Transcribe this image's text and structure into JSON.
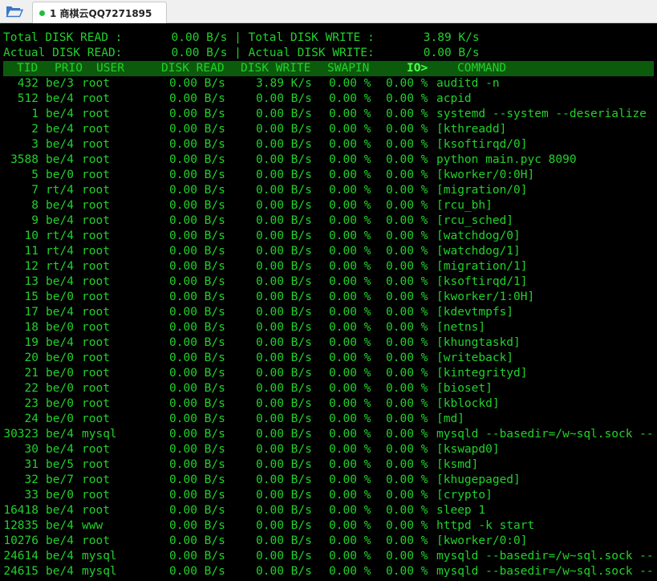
{
  "tab": {
    "title": "1 商棋云QQ7271895"
  },
  "summary": {
    "line1": "Total DISK READ :       0.00 B/s | Total DISK WRITE :       3.89 K/s",
    "line2": "Actual DISK READ:       0.00 B/s | Actual DISK WRITE:       0.00 B/s"
  },
  "header": {
    "tid": "TID",
    "prio": "PRIO",
    "user": "USER",
    "disk_read": "DISK READ",
    "disk_write": "DISK WRITE",
    "swapin": "SWAPIN",
    "io": "IO>",
    "command": "COMMAND"
  },
  "rows": [
    {
      "tid": "432",
      "prio": "be/3",
      "user": "root",
      "read": "0.00 B/s",
      "write": "3.89 K/s",
      "swapin": "0.00 %",
      "io": "0.00 %",
      "cmd": "auditd -n"
    },
    {
      "tid": "512",
      "prio": "be/4",
      "user": "root",
      "read": "0.00 B/s",
      "write": "0.00 B/s",
      "swapin": "0.00 %",
      "io": "0.00 %",
      "cmd": "acpid"
    },
    {
      "tid": "1",
      "prio": "be/4",
      "user": "root",
      "read": "0.00 B/s",
      "write": "0.00 B/s",
      "swapin": "0.00 %",
      "io": "0.00 %",
      "cmd": "systemd --system --deserialize"
    },
    {
      "tid": "2",
      "prio": "be/4",
      "user": "root",
      "read": "0.00 B/s",
      "write": "0.00 B/s",
      "swapin": "0.00 %",
      "io": "0.00 %",
      "cmd": "[kthreadd]"
    },
    {
      "tid": "3",
      "prio": "be/4",
      "user": "root",
      "read": "0.00 B/s",
      "write": "0.00 B/s",
      "swapin": "0.00 %",
      "io": "0.00 %",
      "cmd": "[ksoftirqd/0]"
    },
    {
      "tid": "3588",
      "prio": "be/4",
      "user": "root",
      "read": "0.00 B/s",
      "write": "0.00 B/s",
      "swapin": "0.00 %",
      "io": "0.00 %",
      "cmd": "python main.pyc 8090"
    },
    {
      "tid": "5",
      "prio": "be/0",
      "user": "root",
      "read": "0.00 B/s",
      "write": "0.00 B/s",
      "swapin": "0.00 %",
      "io": "0.00 %",
      "cmd": "[kworker/0:0H]"
    },
    {
      "tid": "7",
      "prio": "rt/4",
      "user": "root",
      "read": "0.00 B/s",
      "write": "0.00 B/s",
      "swapin": "0.00 %",
      "io": "0.00 %",
      "cmd": "[migration/0]"
    },
    {
      "tid": "8",
      "prio": "be/4",
      "user": "root",
      "read": "0.00 B/s",
      "write": "0.00 B/s",
      "swapin": "0.00 %",
      "io": "0.00 %",
      "cmd": "[rcu_bh]"
    },
    {
      "tid": "9",
      "prio": "be/4",
      "user": "root",
      "read": "0.00 B/s",
      "write": "0.00 B/s",
      "swapin": "0.00 %",
      "io": "0.00 %",
      "cmd": "[rcu_sched]"
    },
    {
      "tid": "10",
      "prio": "rt/4",
      "user": "root",
      "read": "0.00 B/s",
      "write": "0.00 B/s",
      "swapin": "0.00 %",
      "io": "0.00 %",
      "cmd": "[watchdog/0]"
    },
    {
      "tid": "11",
      "prio": "rt/4",
      "user": "root",
      "read": "0.00 B/s",
      "write": "0.00 B/s",
      "swapin": "0.00 %",
      "io": "0.00 %",
      "cmd": "[watchdog/1]"
    },
    {
      "tid": "12",
      "prio": "rt/4",
      "user": "root",
      "read": "0.00 B/s",
      "write": "0.00 B/s",
      "swapin": "0.00 %",
      "io": "0.00 %",
      "cmd": "[migration/1]"
    },
    {
      "tid": "13",
      "prio": "be/4",
      "user": "root",
      "read": "0.00 B/s",
      "write": "0.00 B/s",
      "swapin": "0.00 %",
      "io": "0.00 %",
      "cmd": "[ksoftirqd/1]"
    },
    {
      "tid": "15",
      "prio": "be/0",
      "user": "root",
      "read": "0.00 B/s",
      "write": "0.00 B/s",
      "swapin": "0.00 %",
      "io": "0.00 %",
      "cmd": "[kworker/1:0H]"
    },
    {
      "tid": "17",
      "prio": "be/4",
      "user": "root",
      "read": "0.00 B/s",
      "write": "0.00 B/s",
      "swapin": "0.00 %",
      "io": "0.00 %",
      "cmd": "[kdevtmpfs]"
    },
    {
      "tid": "18",
      "prio": "be/0",
      "user": "root",
      "read": "0.00 B/s",
      "write": "0.00 B/s",
      "swapin": "0.00 %",
      "io": "0.00 %",
      "cmd": "[netns]"
    },
    {
      "tid": "19",
      "prio": "be/4",
      "user": "root",
      "read": "0.00 B/s",
      "write": "0.00 B/s",
      "swapin": "0.00 %",
      "io": "0.00 %",
      "cmd": "[khungtaskd]"
    },
    {
      "tid": "20",
      "prio": "be/0",
      "user": "root",
      "read": "0.00 B/s",
      "write": "0.00 B/s",
      "swapin": "0.00 %",
      "io": "0.00 %",
      "cmd": "[writeback]"
    },
    {
      "tid": "21",
      "prio": "be/0",
      "user": "root",
      "read": "0.00 B/s",
      "write": "0.00 B/s",
      "swapin": "0.00 %",
      "io": "0.00 %",
      "cmd": "[kintegrityd]"
    },
    {
      "tid": "22",
      "prio": "be/0",
      "user": "root",
      "read": "0.00 B/s",
      "write": "0.00 B/s",
      "swapin": "0.00 %",
      "io": "0.00 %",
      "cmd": "[bioset]"
    },
    {
      "tid": "23",
      "prio": "be/0",
      "user": "root",
      "read": "0.00 B/s",
      "write": "0.00 B/s",
      "swapin": "0.00 %",
      "io": "0.00 %",
      "cmd": "[kblockd]"
    },
    {
      "tid": "24",
      "prio": "be/0",
      "user": "root",
      "read": "0.00 B/s",
      "write": "0.00 B/s",
      "swapin": "0.00 %",
      "io": "0.00 %",
      "cmd": "[md]"
    },
    {
      "tid": "30323",
      "prio": "be/4",
      "user": "mysql",
      "read": "0.00 B/s",
      "write": "0.00 B/s",
      "swapin": "0.00 %",
      "io": "0.00 %",
      "cmd": "mysqld --basedir=/w~sql.sock --"
    },
    {
      "tid": "30",
      "prio": "be/4",
      "user": "root",
      "read": "0.00 B/s",
      "write": "0.00 B/s",
      "swapin": "0.00 %",
      "io": "0.00 %",
      "cmd": "[kswapd0]"
    },
    {
      "tid": "31",
      "prio": "be/5",
      "user": "root",
      "read": "0.00 B/s",
      "write": "0.00 B/s",
      "swapin": "0.00 %",
      "io": "0.00 %",
      "cmd": "[ksmd]"
    },
    {
      "tid": "32",
      "prio": "be/7",
      "user": "root",
      "read": "0.00 B/s",
      "write": "0.00 B/s",
      "swapin": "0.00 %",
      "io": "0.00 %",
      "cmd": "[khugepaged]"
    },
    {
      "tid": "33",
      "prio": "be/0",
      "user": "root",
      "read": "0.00 B/s",
      "write": "0.00 B/s",
      "swapin": "0.00 %",
      "io": "0.00 %",
      "cmd": "[crypto]"
    },
    {
      "tid": "16418",
      "prio": "be/4",
      "user": "root",
      "read": "0.00 B/s",
      "write": "0.00 B/s",
      "swapin": "0.00 %",
      "io": "0.00 %",
      "cmd": "sleep 1"
    },
    {
      "tid": "12835",
      "prio": "be/4",
      "user": "www",
      "read": "0.00 B/s",
      "write": "0.00 B/s",
      "swapin": "0.00 %",
      "io": "0.00 %",
      "cmd": "httpd -k start"
    },
    {
      "tid": "10276",
      "prio": "be/4",
      "user": "root",
      "read": "0.00 B/s",
      "write": "0.00 B/s",
      "swapin": "0.00 %",
      "io": "0.00 %",
      "cmd": "[kworker/0:0]"
    },
    {
      "tid": "24614",
      "prio": "be/4",
      "user": "mysql",
      "read": "0.00 B/s",
      "write": "0.00 B/s",
      "swapin": "0.00 %",
      "io": "0.00 %",
      "cmd": "mysqld --basedir=/w~sql.sock --"
    },
    {
      "tid": "24615",
      "prio": "be/4",
      "user": "mysql",
      "read": "0.00 B/s",
      "write": "0.00 B/s",
      "swapin": "0.00 %",
      "io": "0.00 %",
      "cmd": "mysqld --basedir=/w~sql.sock --"
    }
  ]
}
